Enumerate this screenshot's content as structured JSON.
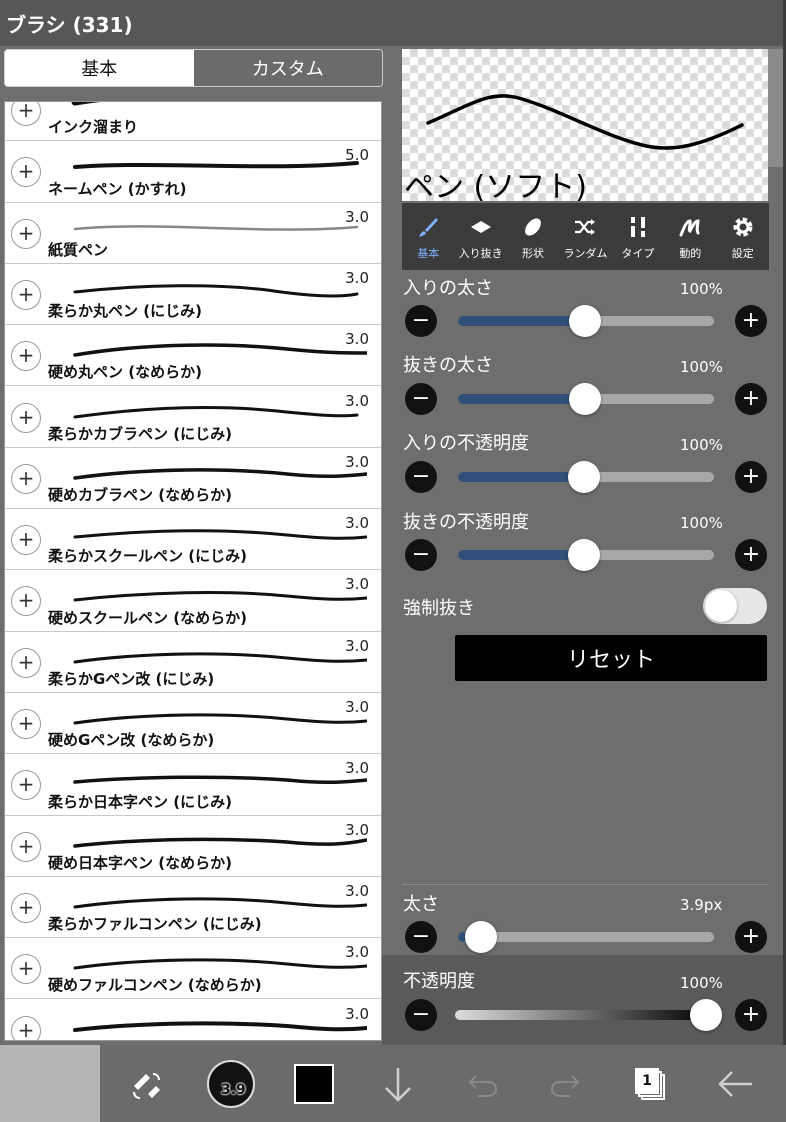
{
  "window": {
    "title": "ブラシ (331)"
  },
  "tabs": [
    {
      "label": "基本",
      "active": true
    },
    {
      "label": "カスタム",
      "active": false
    }
  ],
  "brushes": [
    {
      "name": "インク溜まり",
      "size": ""
    },
    {
      "name": "ネームペン (かすれ)",
      "size": "5.0"
    },
    {
      "name": "紙質ペン",
      "size": "3.0"
    },
    {
      "name": "柔らか丸ペン (にじみ)",
      "size": "3.0"
    },
    {
      "name": "硬め丸ペン (なめらか)",
      "size": "3.0"
    },
    {
      "name": "柔らかカブラペン (にじみ)",
      "size": "3.0"
    },
    {
      "name": "硬めカブラペン (なめらか)",
      "size": "3.0"
    },
    {
      "name": "柔らかスクールペン (にじみ)",
      "size": "3.0"
    },
    {
      "name": "硬めスクールペン (なめらか)",
      "size": "3.0"
    },
    {
      "name": "柔らかGペン改 (にじみ)",
      "size": "3.0"
    },
    {
      "name": "硬めGペン改 (なめらか)",
      "size": "3.0"
    },
    {
      "name": "柔らか日本字ペン (にじみ)",
      "size": "3.0"
    },
    {
      "name": "硬め日本字ペン (なめらか)",
      "size": "3.0"
    },
    {
      "name": "柔らかファルコンペン (にじみ)",
      "size": "3.0"
    },
    {
      "name": "硬めファルコンペン (なめらか)",
      "size": "3.0"
    },
    {
      "name": "",
      "size": "3.0"
    }
  ],
  "preview": {
    "brush_name": "ペン (ソフト)"
  },
  "toolbar": {
    "items": [
      {
        "label": "基本",
        "icon": "brush-icon",
        "active": true
      },
      {
        "label": "入り抜き",
        "icon": "taper-icon",
        "active": false
      },
      {
        "label": "形状",
        "icon": "shape-icon",
        "active": false
      },
      {
        "label": "ランダム",
        "icon": "shuffle-icon",
        "active": false
      },
      {
        "label": "タイプ",
        "icon": "type-icon",
        "active": false
      },
      {
        "label": "動的",
        "icon": "dynamic-icon",
        "active": false
      },
      {
        "label": "設定",
        "icon": "gear-icon",
        "active": false
      }
    ]
  },
  "settings": {
    "start_thickness": {
      "label": "入りの太さ",
      "value": "100%",
      "level": 0.5
    },
    "end_thickness": {
      "label": "抜きの太さ",
      "value": "100%",
      "level": 0.5
    },
    "start_opacity": {
      "label": "入りの不透明度",
      "value": "100%",
      "level": 0.5
    },
    "end_opacity": {
      "label": "抜きの不透明度",
      "value": "100%",
      "level": 0.5
    },
    "force_taper": {
      "label": "強制抜き",
      "on": false
    },
    "reset_label": "リセット",
    "size": {
      "label": "太さ",
      "value": "3.9px",
      "level": 0.03
    },
    "opacity": {
      "label": "不透明度",
      "value": "100%",
      "level": 1.0
    }
  },
  "bottom_bar": {
    "brush_size_badge": "3.9",
    "color": "#000000",
    "layer_count": "1"
  },
  "colors": {
    "accent": "#2f4f78",
    "active_tab_label": "#7fb2ff"
  }
}
